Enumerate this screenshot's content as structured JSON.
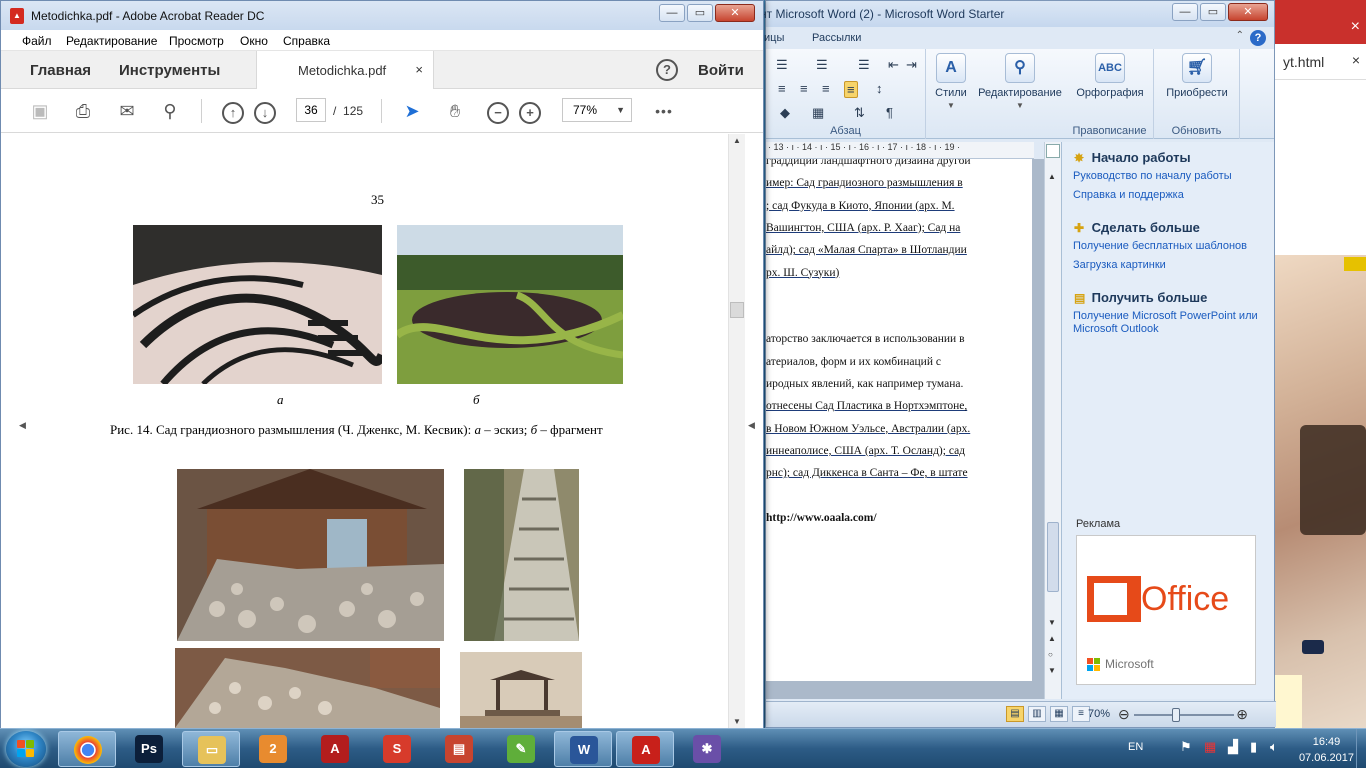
{
  "acrobat": {
    "title": "Metodichka.pdf - Adobe Acrobat Reader DC",
    "menu": [
      "Файл",
      "Редактирование",
      "Просмотр",
      "Окно",
      "Справка"
    ],
    "tabs": {
      "home": "Главная",
      "tools": "Инструменты",
      "doc": "Metodichka.pdf",
      "close": "×",
      "signin": "Войти",
      "help": "?"
    },
    "toolbar": {
      "page_current": "36",
      "page_sep": "/",
      "page_total": "125",
      "zoom": "77%",
      "more": "•••"
    },
    "document": {
      "page_number": "35",
      "fig_a_label": "а",
      "fig_b_label": "б",
      "caption_main": "Рис. 14. Сад грандиозного размышления (Ч. Дженкс, М. Кесвик): ",
      "caption_a": "а",
      "caption_mid": " – эскиз; ",
      "caption_b": "б",
      "caption_end": " – фрагмент"
    }
  },
  "word": {
    "title": "нт Microsoft Word (2)  -  Microsoft Word Starter",
    "tabs": [
      "ицы",
      "Рассылки"
    ],
    "help": "?",
    "ribbon": {
      "styles": "Стили",
      "editing": "Редактирование",
      "spelling": "Орфография",
      "buy": "Приобрести",
      "group_paragraph": "Абзац",
      "group_proofing": "Правописание",
      "group_update": "Обновить",
      "abc": "ABC"
    },
    "ruler": "· 13 · ı · 14 · ı · 15 · ı · 16 · ı · 17 · ı · 18 · ı · 19 ·",
    "document_lines": [
      "граддиции ландшафтного дизайна другой",
      "имер: Сад грандиозного размышления в",
      "; сад Фукуда в Киото, Японии (арх. М.",
      "Вашингтон, США (арх. Р. Хааг); Сад на",
      "айлд); сад «Малая Спарта» в Шотландии",
      "рх. Ш. Сузуки)",
      "",
      "",
      "аторство заключается в использовании в",
      "атериалов,  форм  и  их  комбинаций  с",
      "иродных явлений, как например тумана.",
      "отнесены Сад Пластика в Нортхэмптоне,",
      "в Новом Южном Уэльсе, Австралии (арх.",
      "иннеаполисе, США (арх. Т. Осланд); сад",
      "рнс); сад Диккенса в Санта – Фе, в штате",
      "",
      "http://www.oaala.com/"
    ],
    "taskpane": {
      "section1_title": "Начало работы",
      "section1_links": [
        "Руководство по началу работы",
        "Справка и поддержка"
      ],
      "section2_title": "Сделать больше",
      "section2_links": [
        "Получение бесплатных шаблонов",
        "Загрузка картинки"
      ],
      "section3_title": "Получить больше",
      "section3_links": [
        "Получение Microsoft PowerPoint или Microsoft Outlook"
      ],
      "ad_label": "Реклама",
      "ad_office": "Office",
      "ad_microsoft": "Microsoft"
    },
    "status": {
      "zoom": "70%",
      "zoom_level_percent": 70
    }
  },
  "browser": {
    "address_fragment": "yt.html",
    "close": "×"
  },
  "taskbar": {
    "apps": [
      "chrome",
      "photoshop",
      "file-explorer",
      "paint-app",
      "acrobat-pro",
      "sketchup",
      "presentation-app",
      "gallery-app",
      "word",
      "acrobat-reader",
      "network-app"
    ],
    "lang": "EN",
    "time": "16:49",
    "date": "07.06.2017"
  },
  "colors": {
    "office_orange": "#e64a19",
    "link_blue": "#1a5bbf",
    "acrobat_red": "#d42a1f"
  }
}
